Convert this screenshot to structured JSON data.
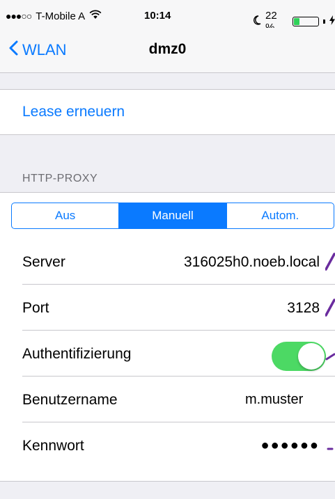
{
  "status_bar": {
    "signal": "●●●○○",
    "carrier": "T-Mobile A",
    "time": "10:14",
    "battery_text": "22 %",
    "battery_level": 0.22,
    "icons": [
      "wifi-icon",
      "moon-icon",
      "battery-icon",
      "charging-icon"
    ]
  },
  "nav": {
    "back_label": "WLAN",
    "title": "dmz0"
  },
  "lease": {
    "label": "Lease erneuern"
  },
  "proxy": {
    "section_header": "HTTP-PROXY",
    "segments": [
      {
        "label": "Aus",
        "selected": false
      },
      {
        "label": "Manuell",
        "selected": true
      },
      {
        "label": "Autom.",
        "selected": false
      }
    ],
    "server_label": "Server",
    "server_value": "316025h0.noeb.local",
    "port_label": "Port",
    "port_value": "3128",
    "auth_label": "Authentifizierung",
    "auth_enabled": true,
    "username_label": "Benutzername",
    "username_value": "m.muster",
    "password_label": "Kennwort",
    "password_value": "●●●●●●"
  },
  "colors": {
    "accent": "#0a7aff",
    "toggle_on": "#4cd964",
    "background": "#efeff4",
    "annotation": "#6a2c9e"
  }
}
